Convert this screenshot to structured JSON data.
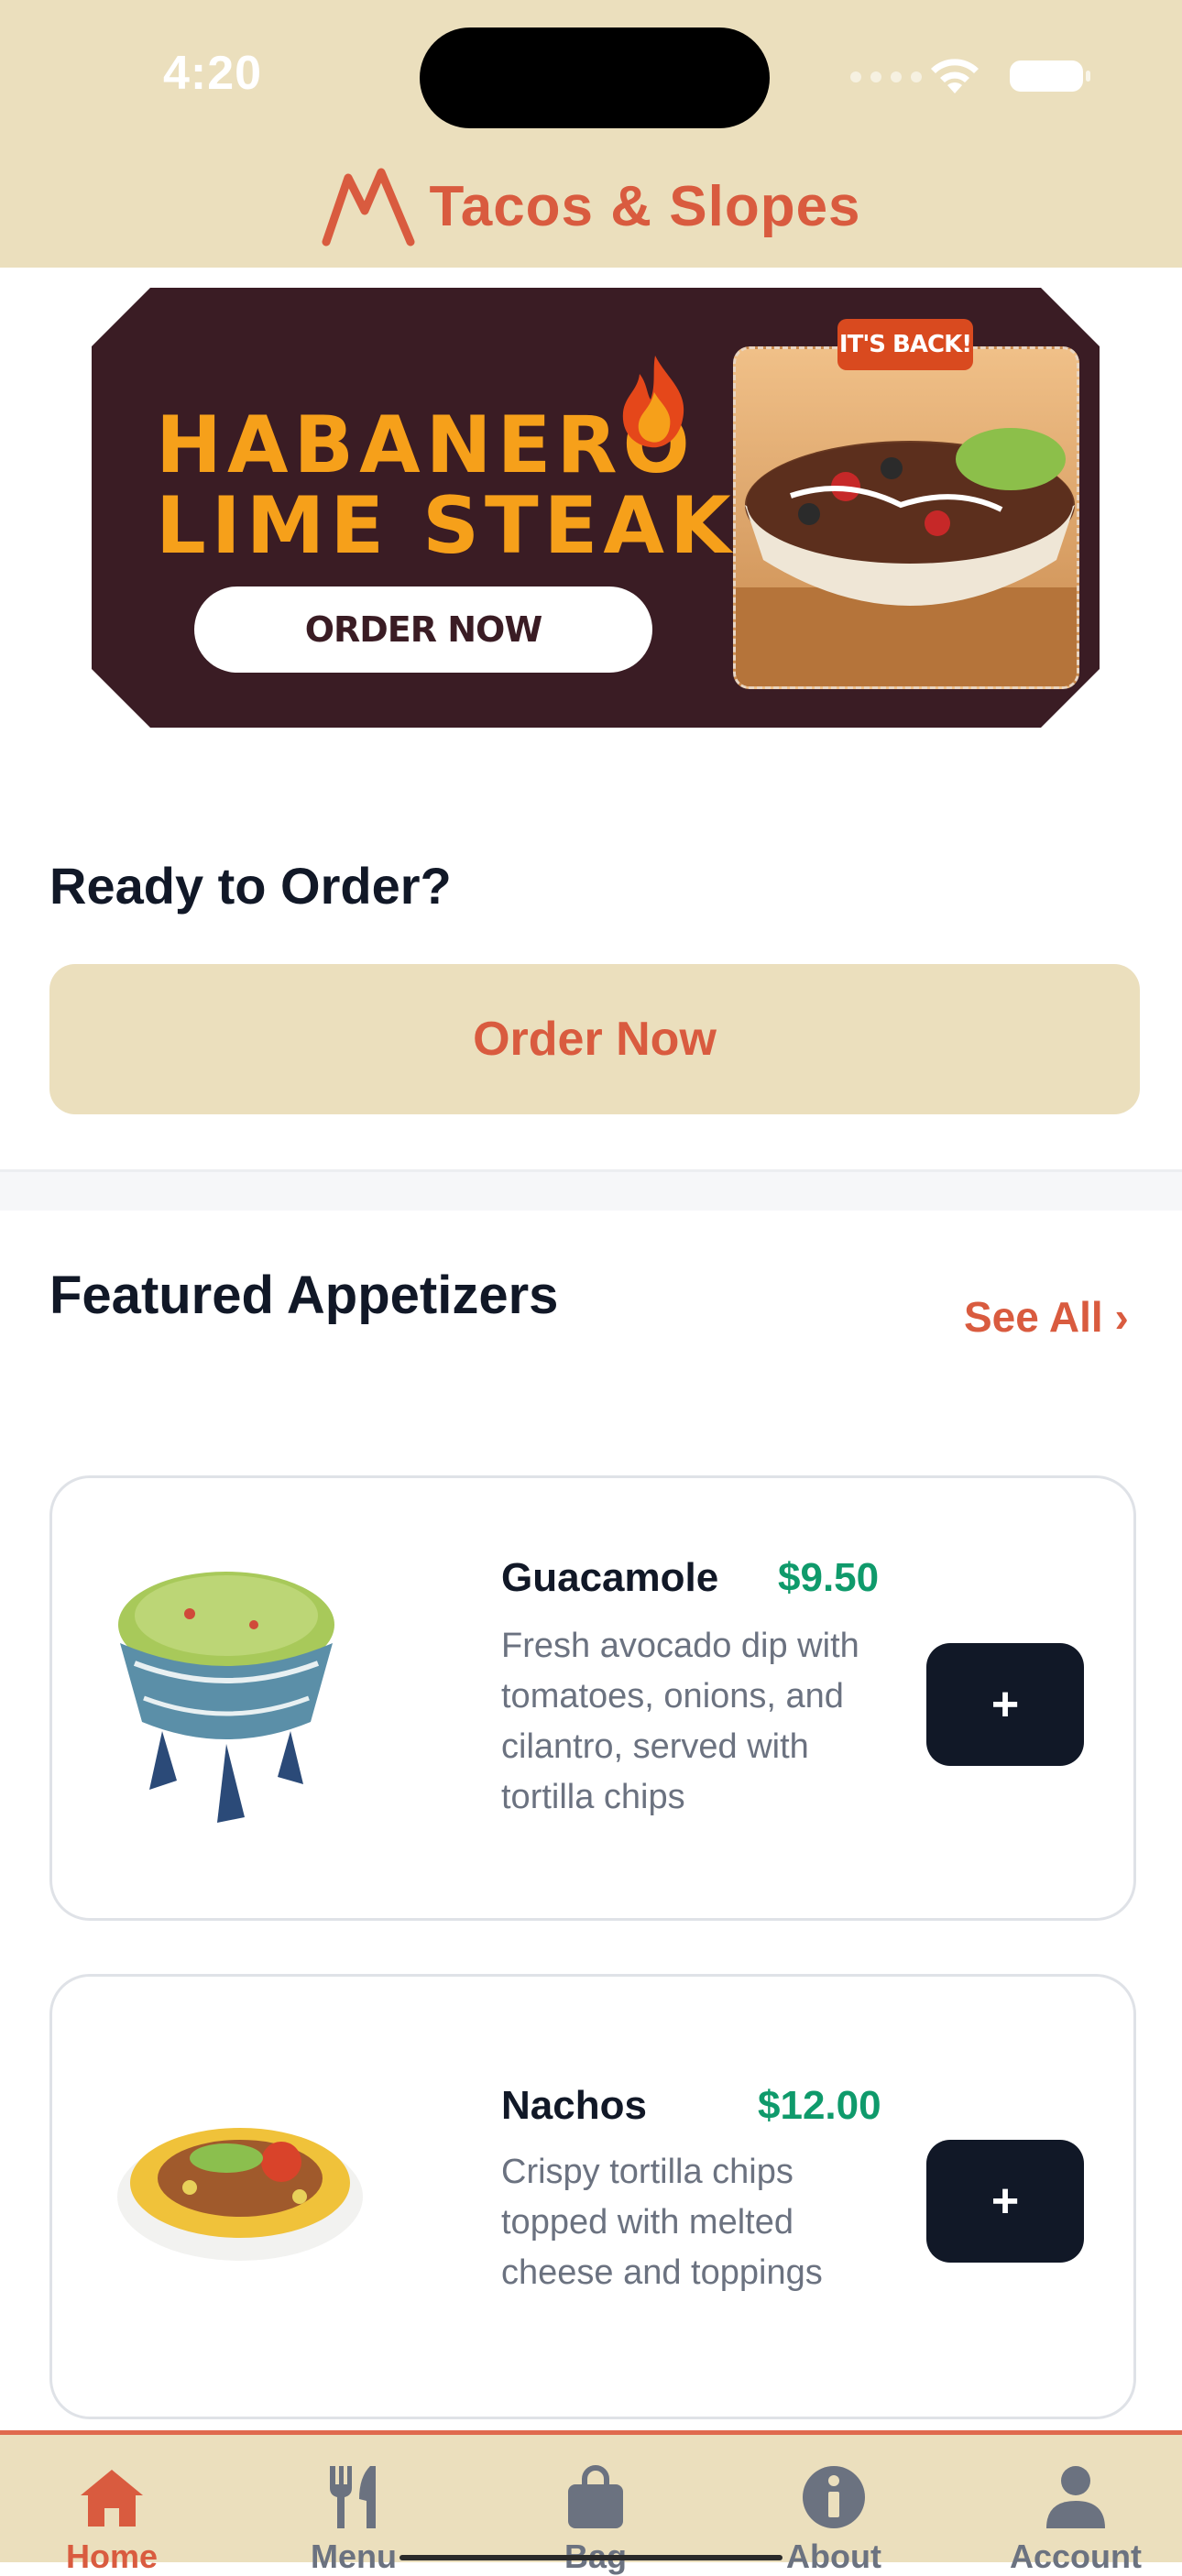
{
  "status_bar": {
    "time": "4:20"
  },
  "header": {
    "brand_name": "Tacos & Slopes"
  },
  "promo": {
    "title_line1": "HABANERO",
    "title_line2": "LIME STEAK",
    "button_label": "ORDER NOW",
    "tag": "IT'S BACK!"
  },
  "ready": {
    "title": "Ready to Order?",
    "button_label": "Order Now"
  },
  "featured": {
    "title": "Featured Appetizers",
    "see_all": "See All ›",
    "items": [
      {
        "name": "Guacamole",
        "price": "$9.50",
        "description": "Fresh avocado dip with tomatoes, onions, and cilantro, served with tortilla chips",
        "add_label": "+"
      },
      {
        "name": "Nachos",
        "price": "$12.00",
        "description": "Crispy tortilla chips topped with melted cheese and toppings",
        "add_label": "+"
      }
    ]
  },
  "tabs": [
    {
      "label": "Home",
      "icon": "home-icon",
      "active": true
    },
    {
      "label": "Menu",
      "icon": "fork-knife-icon",
      "active": false
    },
    {
      "label": "Bag",
      "icon": "bag-icon",
      "active": false
    },
    {
      "label": "About",
      "icon": "info-icon",
      "active": false
    },
    {
      "label": "Account",
      "icon": "person-icon",
      "active": false
    }
  ],
  "colors": {
    "header_bg": "#ebdfbd",
    "accent": "#d95b3f",
    "price": "#0f9a6b",
    "banner_bg": "#3a1c24",
    "banner_text": "#f6a01a",
    "add_button": "#111827"
  }
}
